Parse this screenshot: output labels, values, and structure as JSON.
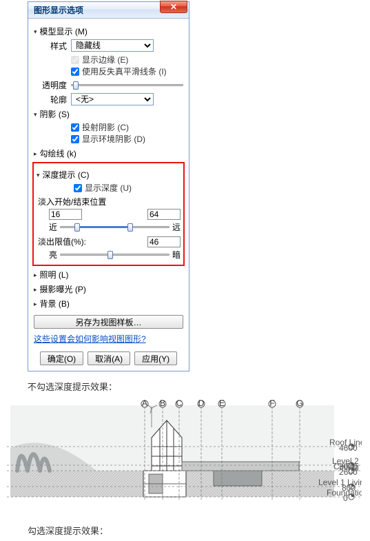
{
  "dialog": {
    "title": "图形显示选项",
    "sections": {
      "model_display": {
        "label": "模型显示 (M)",
        "style_label": "样式",
        "style_value": "隐藏线",
        "show_edges": "显示边缘 (E)",
        "anti_alias": "使用反失真平滑线条 (I)",
        "transparency_label": "透明度",
        "silhouette_label": "轮廓",
        "silhouette_value": "<无>"
      },
      "shadows": {
        "label": "阴影 (S)",
        "cast": "投射阴影 (C)",
        "ambient": "显示环境阴影 (D)"
      },
      "sketchy": {
        "label": "勾绘线 (k)"
      },
      "depth": {
        "label": "深度提示 (C)",
        "show_depth": "显示深度 (U)",
        "fade_range_label": "淡入开始/结束位置",
        "fade_start": "16",
        "fade_end": "64",
        "near": "近",
        "far": "远",
        "limit_label": "淡出限值(%):",
        "limit_value": "46",
        "light": "亮",
        "dark": "暗"
      },
      "lighting": {
        "label": "照明 (L)"
      },
      "photo_exposure": {
        "label": "摄影曝光 (P)"
      },
      "background": {
        "label": "背景 (B)"
      }
    },
    "save_template": "另存为视图样板…",
    "help_link": "这些设置会如何影响视图图形?",
    "buttons": {
      "ok": "确定(O)",
      "cancel": "取消(A)",
      "apply": "应用(Y)"
    }
  },
  "caption_off": "不勾选深度提示效果：",
  "caption_on": "勾选深度提示效果：",
  "grids": [
    "A",
    "B",
    "C",
    "D",
    "E",
    "F",
    "G"
  ]
}
